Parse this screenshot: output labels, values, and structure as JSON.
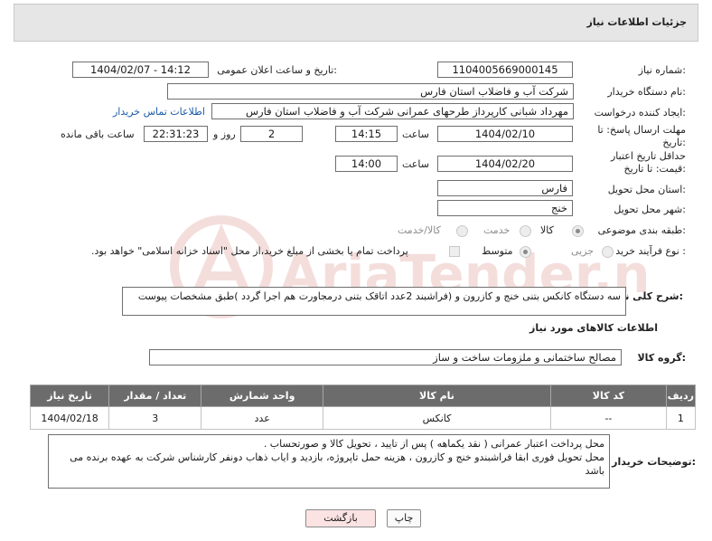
{
  "header": {
    "title": "جزئیات اطلاعات نیاز"
  },
  "watermark": {
    "text": "AriaTender.neT"
  },
  "form": {
    "need_number": {
      "label": "شماره نیاز:",
      "value": "1104005669000145"
    },
    "announce_datetime": {
      "label": "تاریخ و ساعت اعلان عمومی:",
      "value": "1404/02/07 - 14:12"
    },
    "buyer_org": {
      "label": "نام دستگاه خریدار:",
      "value": "شرکت آب و فاضلاب استان فارس"
    },
    "requester": {
      "label": "ایجاد کننده درخواست:",
      "value": "مهرداد شبانی کارپرداز طرحهای عمرانی  شرکت آب و فاضلاب استان فارس",
      "contact_link": "اطلاعات تماس خریدار"
    },
    "deadline": {
      "label": "مهلت ارسال پاسخ: تا تاریخ:",
      "date": "1404/02/10",
      "time_label": "ساعت",
      "time": "14:15",
      "days": "2",
      "days_label": "روز و",
      "remaining": "22:31:23",
      "remaining_label": "ساعت باقی مانده"
    },
    "price_validity": {
      "label": "حداقل تاریخ اعتبار قیمت: تا تاریخ:",
      "date": "1404/02/20",
      "time_label": "ساعت",
      "time": "14:00"
    },
    "province": {
      "label": "استان محل تحویل:",
      "value": "فارس"
    },
    "city": {
      "label": "شهر محل تحویل:",
      "value": "خنج"
    },
    "category": {
      "label": "طبقه بندی موضوعی:",
      "options": [
        "کالا",
        "خدمت",
        "کالا/خدمت"
      ],
      "selected": "کالا"
    },
    "process": {
      "label": "نوع فرآیند خرید :",
      "options": [
        "جزیی",
        "متوسط"
      ],
      "selected": "متوسط",
      "note": "پرداخت تمام یا بخشی از مبلغ خرید،از محل \"اسناد خزانه اسلامی\" خواهد بود."
    },
    "description": {
      "label": "شرح کلی نیاز:",
      "value": "سه دستگاه  کانکس بتنی  خنج  و کازرون و (فراشبند  2عدد اتاقک بتنی درمجاورت هم  اجرا گردد )طبق مشخصات پیوست"
    }
  },
  "goods": {
    "section_title": "اطلاعات کالاهای مورد نیاز",
    "group_label": "گروه کالا:",
    "group_value": "مصالح ساختمانی و ملزومات ساخت و ساز",
    "columns": [
      "ردیف",
      "کد کالا",
      "نام کالا",
      "واحد شمارش",
      "تعداد / مقدار",
      "تاریخ نیاز"
    ],
    "rows": [
      {
        "row": "1",
        "code": "--",
        "name": "کانکس",
        "unit": "عدد",
        "qty": "3",
        "date": "1404/02/18"
      }
    ]
  },
  "buyer_notes": {
    "label": "توضیحات خریدار:",
    "value": "محل پرداخت اعتبار عمرانی ( نقد یکماهه ) پس از تایید ، تحویل کالا و صورتحساب .\nمحل تحویل فوری ابقا فراشبندو خنج و کازرون ، هزینه حمل تاپروژه، بازدید و ایاب ذهاب دونفر کارشناس شرکت به عهده برنده می باشد"
  },
  "buttons": {
    "print": "چاپ",
    "back": "بازگشت"
  },
  "colors": {
    "link": "#1a5aa8",
    "table_header": "#6c6c6c",
    "back_button": "#fbe3e3"
  }
}
